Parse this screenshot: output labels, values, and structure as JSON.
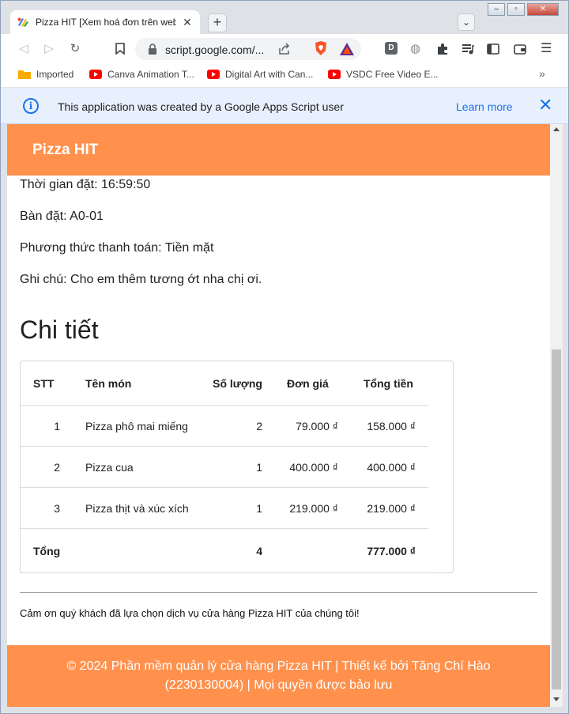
{
  "browser": {
    "tab_title": "Pizza HIT [Xem hoá đơn trên web",
    "url": "script.google.com/...",
    "bookmarks": [
      {
        "label": "Imported",
        "icon": "folder-icon"
      },
      {
        "label": "Canva Animation T...",
        "icon": "youtube-icon"
      },
      {
        "label": "Digital Art with Can...",
        "icon": "youtube-icon"
      },
      {
        "label": "VSDC Free Video E...",
        "icon": "youtube-icon"
      }
    ],
    "info_bar": {
      "message": "This application was created by a Google Apps Script user",
      "link": "Learn more"
    }
  },
  "page": {
    "brand": "Pizza HIT",
    "info": [
      "Thời gian đặt: 16:59:50",
      "Bàn đặt: A0-01",
      "Phương thức thanh toán: Tiền mặt",
      "Ghi chú: Cho em thêm tương ớt nha chị ơi."
    ],
    "section_title": "Chi tiết",
    "table": {
      "headers": [
        "STT",
        "Tên món",
        "Số lượng",
        "Đơn giá",
        "Tổng tiền"
      ],
      "rows": [
        [
          "1",
          "Pizza phô mai miếng",
          "2",
          "79.000 ₫",
          "158.000 ₫"
        ],
        [
          "2",
          "Pizza cua",
          "1",
          "400.000 ₫",
          "400.000 ₫"
        ],
        [
          "3",
          "Pizza thịt và xúc xích",
          "1",
          "219.000 ₫",
          "219.000 ₫"
        ]
      ],
      "total": {
        "label": "Tổng",
        "qty": "4",
        "amount": "777.000 ₫"
      }
    },
    "thanks": "Cảm ơn quý khách đã lựa chọn dịch vụ cửa hàng Pizza HIT của chúng tôi!",
    "footer_line1": "© 2024 Phần mềm quản lý cửa hàng Pizza HIT | Thiết kế bởi Tăng Chí Hào",
    "footer_line2": "(2230130004) | Mọi quyền được bảo lưu"
  },
  "colors": {
    "header": "#ff914d",
    "link": "#1a73e8"
  }
}
